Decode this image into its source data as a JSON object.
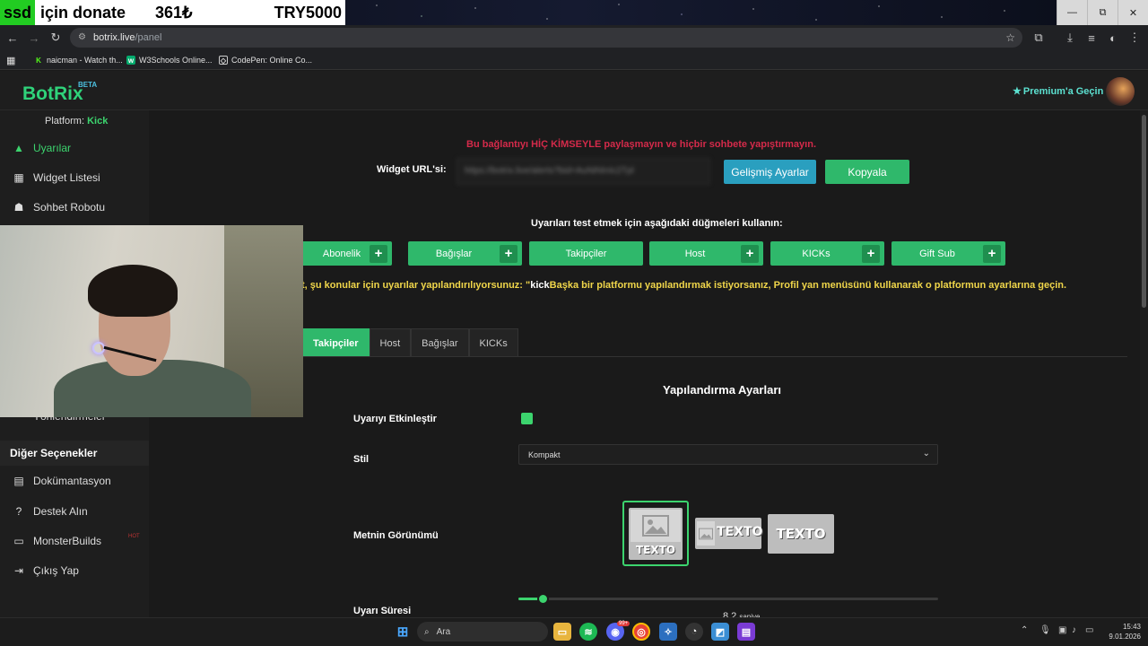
{
  "stream_overlay": {
    "tag": "ssd",
    "label": "için donate",
    "amount": "361₺",
    "goal": "TRY5000"
  },
  "browser": {
    "url_host": "botrix.live",
    "url_path": "/panel",
    "bookmarks": [
      {
        "label": "naicman - Watch th..."
      },
      {
        "label": "W3Schools Online..."
      },
      {
        "label": "CodePen: Online Co..."
      }
    ],
    "window_buttons": {
      "minimize": "—",
      "restore": "⧉",
      "close": "✕"
    }
  },
  "header": {
    "logo": "BotRix",
    "badge": "BETA",
    "premium_icon": "star-icon",
    "premium_label": "Premium'a Geçin"
  },
  "sidebar": {
    "platform_label": "Platform:",
    "platform_value": "Kick",
    "items": [
      {
        "label": "Uyarılar",
        "icon": "warning-icon",
        "active": true
      },
      {
        "label": "Widget Listesi",
        "icon": "grid-icon"
      },
      {
        "label": "Sohbet Robotu",
        "icon": "robot-icon"
      }
    ],
    "partial_item": "Yönlendirmeler",
    "other_heading": "Diğer Seçenekler",
    "other_items": [
      {
        "label": "Dokümantasyon",
        "icon": "document-icon"
      },
      {
        "label": "Destek Alın",
        "icon": "question-icon"
      },
      {
        "label": "MonsterBuilds",
        "icon": "laptop-icon",
        "badge": "HOT"
      },
      {
        "label": "Çıkış Yap",
        "icon": "logout-icon"
      }
    ]
  },
  "main": {
    "warning": "Bu bağlantıyı HİÇ KİMSEYLE paylaşmayın ve hiçbir sohbete yapıştırmayın.",
    "widget_url_label": "Widget URL'si:",
    "widget_url_value": "https://botrix.live/alerts?bid=AuNiNInIc2Tpl",
    "advanced_button": "Gelişmiş Ayarlar",
    "copy_button": "Kopyala",
    "test_heading": "Uyarıları test etmek için aşağıdaki düğmeleri kullanın:",
    "test_buttons": [
      "Abonelik",
      "Bağışlar",
      "Takipçiler",
      "Host",
      "KICKs",
      "Gift Sub"
    ],
    "notice_prefix": "t, şu konular için uyarılar yapılandırılıyorsunuz: \"",
    "notice_platform": "kick",
    "notice_suffix": "Başka bir platformu yapılandırmak istiyorsanız, Profil yan menüsünü kullanarak o platformun ayarlarına geçin.",
    "tabs": [
      "Takipçiler",
      "Host",
      "Bağışlar",
      "KICKs"
    ],
    "active_tab": "Takipçiler",
    "config_title": "Yapılandırma Ayarları",
    "enable_label": "Uyarıyı Etkinleştir",
    "enable_value": true,
    "style_label": "Stil",
    "style_value": "Kompakt",
    "text_view_label": "Metnin Görünümü",
    "texto": "TEXTO",
    "duration_label": "Uyarı Süresi",
    "duration_value": "8.2",
    "duration_unit": "saniye",
    "duration_fraction": 0.06
  },
  "taskbar": {
    "search_placeholder": "Ara",
    "time": "15:43",
    "date": "9.01.2026",
    "discord_badge": "99+"
  },
  "colors": {
    "accent_green": "#2fb86b",
    "info_blue": "#2a9fbf",
    "danger_red": "#d42a4a",
    "notice_yellow": "#f0d64a"
  }
}
